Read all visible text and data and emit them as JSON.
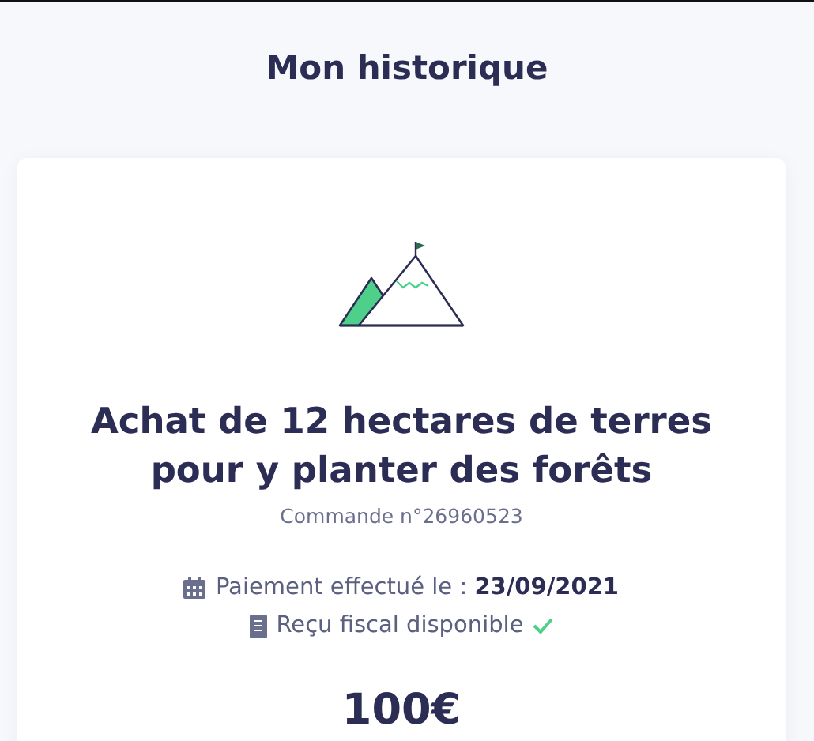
{
  "page_title": "Mon historique",
  "order": {
    "kind": "picture_mountain",
    "title": "Achat de 12 hectares de terres pour y planter des forêts",
    "order_number": "Commande n°26960523",
    "payment": "Paiement effectué le : **23/09/2021**",
    "receipt": {
      "label": "Reçu fiscal disponible",
      "available": true
    },
    "amount": "100€"
  }
}
